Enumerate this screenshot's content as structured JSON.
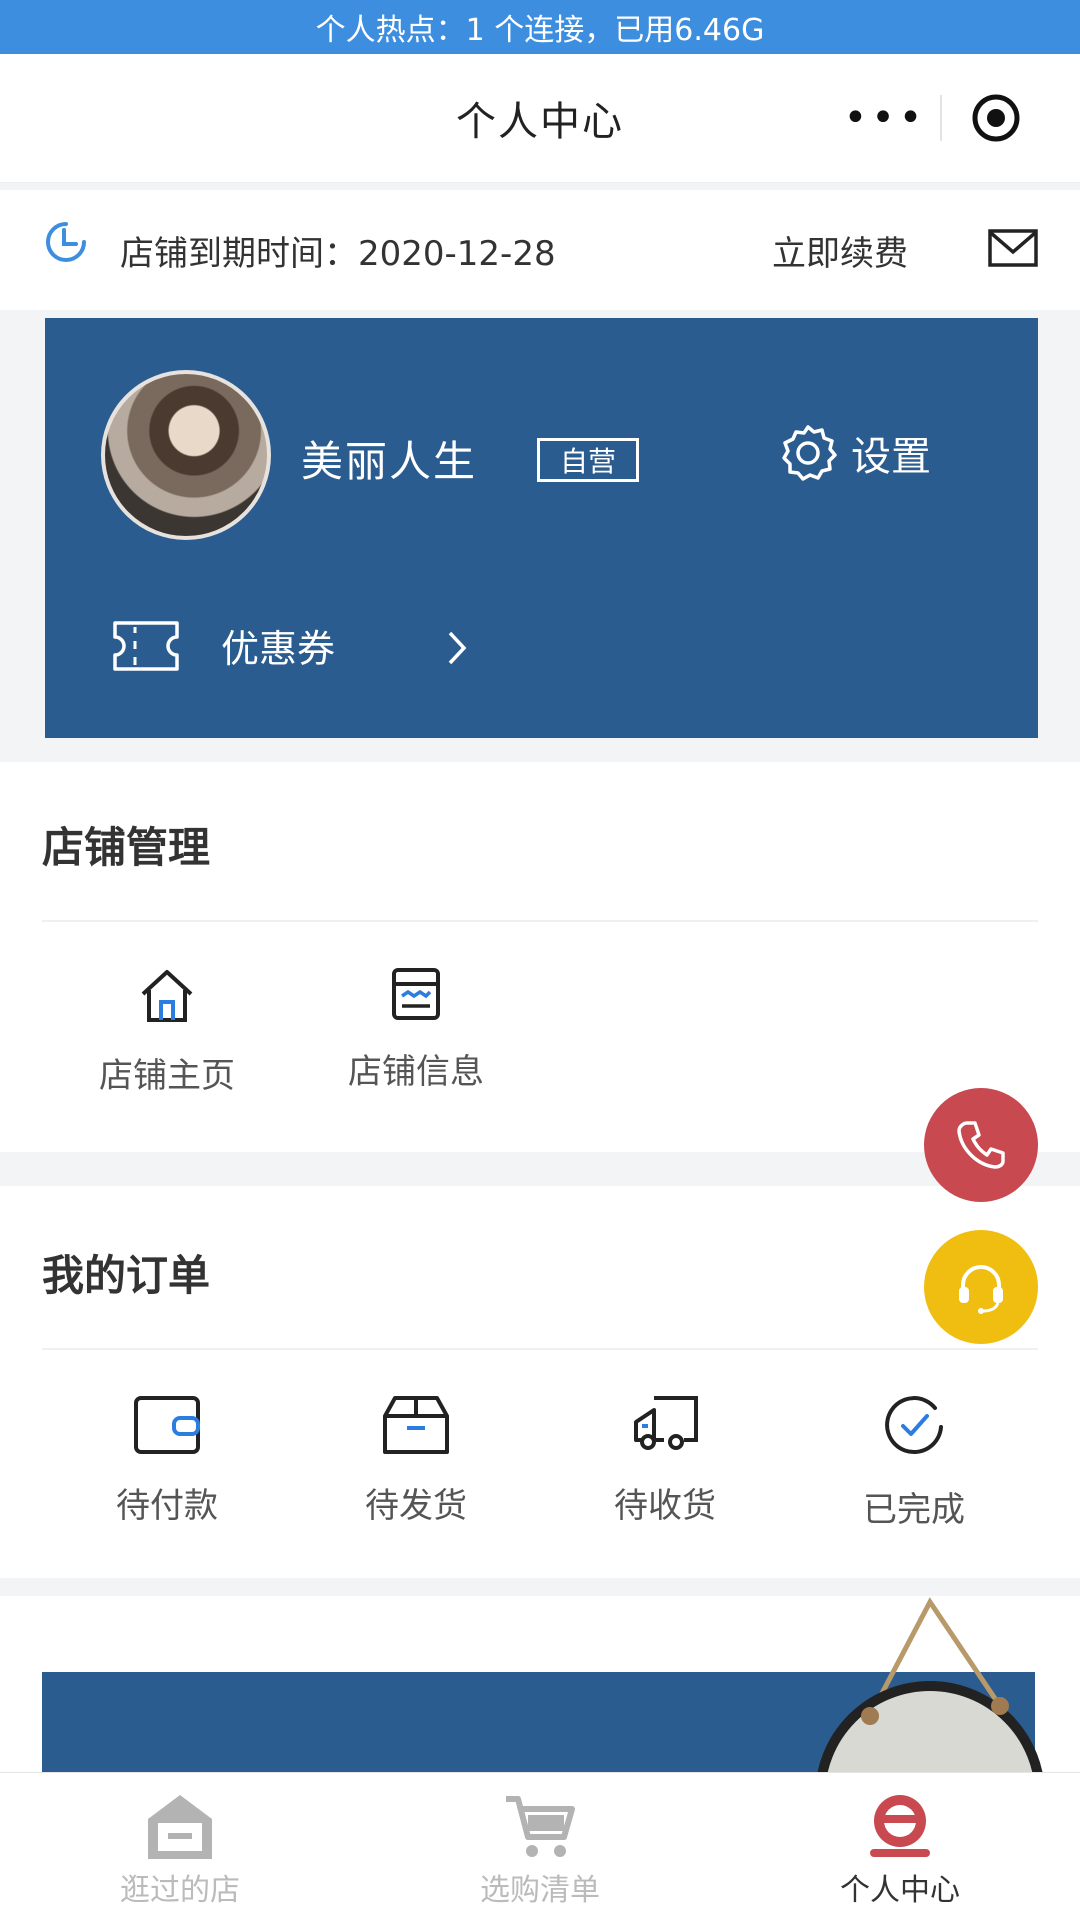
{
  "status_bar": {
    "hotspot_text": "个人热点：1 个连接，已用6.46G"
  },
  "navbar": {
    "title": "个人中心",
    "more_label": "•••"
  },
  "expiry": {
    "label": "店铺到期时间：2020-12-28",
    "renew_label": "立即续费"
  },
  "profile": {
    "name": "美丽人生",
    "badge": "自营",
    "settings_label": "设置",
    "coupon_label": "优惠券"
  },
  "store_management": {
    "title": "店铺管理",
    "items": [
      {
        "label": "店铺主页",
        "icon": "house-icon"
      },
      {
        "label": "店铺信息",
        "icon": "store-info-icon"
      }
    ]
  },
  "my_orders": {
    "title": "我的订单",
    "items": [
      {
        "label": "待付款",
        "icon": "wallet-icon"
      },
      {
        "label": "待发货",
        "icon": "package-icon"
      },
      {
        "label": "待收货",
        "icon": "truck-icon"
      },
      {
        "label": "已完成",
        "icon": "check-circle-icon"
      }
    ]
  },
  "float_buttons": {
    "phone_icon": "phone-icon",
    "service_icon": "headset-icon"
  },
  "tabbar": {
    "items": [
      {
        "label": "逛过的店",
        "icon": "shop-icon",
        "active": false
      },
      {
        "label": "选购清单",
        "icon": "cart-icon",
        "active": false
      },
      {
        "label": "个人中心",
        "icon": "user-icon",
        "active": true
      }
    ]
  },
  "colors": {
    "brand_blue": "#2b5c8f",
    "phone_red": "#c8494f",
    "service_yellow": "#f0be10",
    "hotspot_blue": "#3e8ee0"
  }
}
